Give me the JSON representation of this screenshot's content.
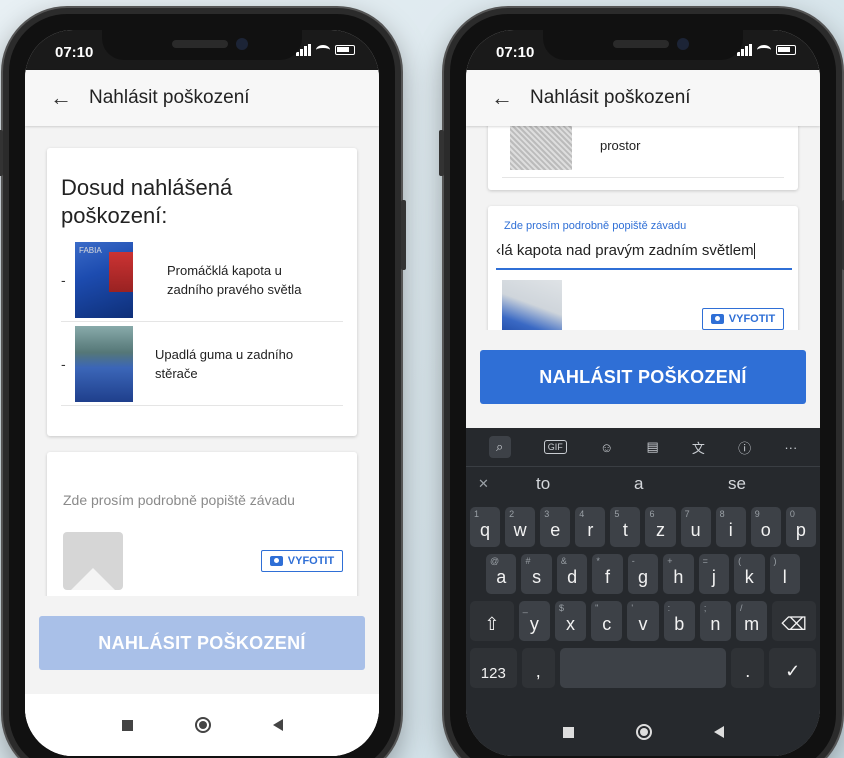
{
  "left_phone": {
    "status": {
      "time": "07:10"
    },
    "appbar": {
      "back": "←",
      "title": "Nahlásit poškození"
    },
    "reported": {
      "heading": "Dosud nahlášená poškození:",
      "items": [
        {
          "dash": "-",
          "label": "Promáčklá kapota u zadního pravého světla"
        },
        {
          "dash": "-",
          "label": "Upadlá guma u zadního stěrače"
        }
      ]
    },
    "new_report": {
      "placeholder": "Zde prosím podrobně popiště závadu",
      "camera_button": "VYFOTIT"
    },
    "submit": {
      "label": "NAHLÁSIT POŠKOZENÍ",
      "color": "#a9c0e8"
    }
  },
  "right_phone": {
    "status": {
      "time": "07:10"
    },
    "appbar": {
      "back": "←",
      "title": "Nahlásit poškození"
    },
    "prev_item_tail": "prostor",
    "new_report": {
      "field_label": "Zde prosím podrobně popiště závadu",
      "field_value": "‹lá kapota nad pravým zadním světlem",
      "camera_button": "VYFOTIT"
    },
    "submit": {
      "label": "NAHLÁSIT POŠKOZENÍ",
      "color": "#2f6fd6"
    },
    "keyboard": {
      "toolbar": [
        "search-icon",
        "GIF",
        "sticker-icon",
        "clipboard-icon",
        "translate-icon",
        "ⓘ",
        "···"
      ],
      "suggestions": [
        "to",
        "a",
        "se"
      ],
      "row1": [
        [
          "q",
          "1"
        ],
        [
          "w",
          "2"
        ],
        [
          "e",
          "3"
        ],
        [
          "r",
          "4"
        ],
        [
          "t",
          "5"
        ],
        [
          "z",
          "6"
        ],
        [
          "u",
          "7"
        ],
        [
          "i",
          "8"
        ],
        [
          "o",
          "9"
        ],
        [
          "p",
          "0"
        ]
      ],
      "row2": [
        [
          "a",
          "@"
        ],
        [
          "s",
          "#"
        ],
        [
          "d",
          "&"
        ],
        [
          "f",
          "*"
        ],
        [
          "g",
          "-"
        ],
        [
          "h",
          "+"
        ],
        [
          "j",
          "="
        ],
        [
          "k",
          "("
        ],
        [
          "l",
          ")"
        ]
      ],
      "row3": [
        [
          "y",
          "_"
        ],
        [
          "x",
          "$"
        ],
        [
          "c",
          "\""
        ],
        [
          "v",
          "'"
        ],
        [
          "b",
          ":"
        ],
        [
          "n",
          ";"
        ],
        [
          "m",
          "/"
        ]
      ],
      "bottom": {
        "numbers": "123",
        "comma": ",",
        "period": ".",
        "enter": "✓"
      }
    }
  }
}
